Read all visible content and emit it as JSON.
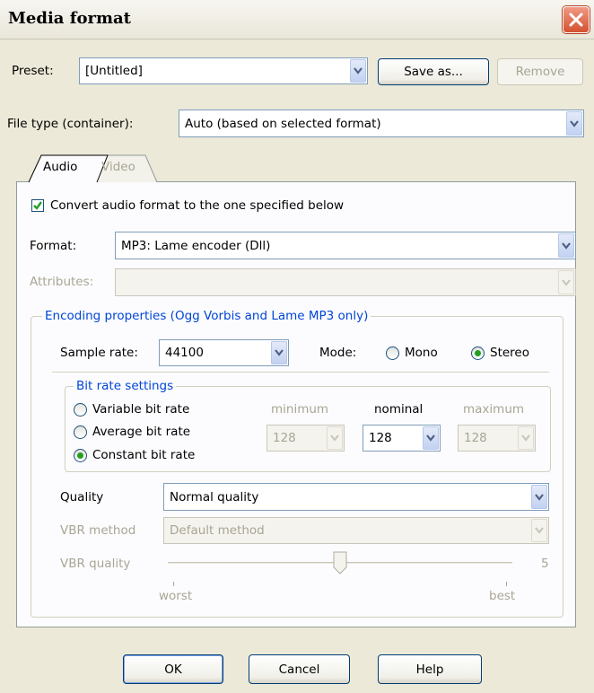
{
  "window": {
    "title": "Media format"
  },
  "preset": {
    "label": "Preset:",
    "value": "[Untitled]",
    "save_as_label": "Save as...",
    "remove_label": "Remove"
  },
  "file_type": {
    "label": "File type (container):",
    "value": "Auto (based on selected format)"
  },
  "tabs": [
    {
      "label": "Audio",
      "active": true
    },
    {
      "label": "Video",
      "active": false
    }
  ],
  "audio": {
    "convert_label": "Convert audio format to the one specified below",
    "convert_checked": true,
    "format_label": "Format:",
    "format_value": "MP3: Lame encoder (Dll)",
    "attributes_label": "Attributes:",
    "attributes_value": "",
    "encoding": {
      "title": "Encoding properties (Ogg Vorbis and Lame MP3 only)",
      "sample_rate_label": "Sample rate:",
      "sample_rate_value": "44100",
      "mode_label": "Mode:",
      "mono_label": "Mono",
      "stereo_label": "Stereo",
      "mode_selected": "Stereo",
      "bitrate": {
        "title": "Bit rate settings",
        "variable_label": "Variable bit rate",
        "average_label": "Average bit rate",
        "constant_label": "Constant bit rate",
        "selected": "Constant bit rate",
        "minimum_label": "minimum",
        "nominal_label": "nominal",
        "maximum_label": "maximum",
        "minimum_value": "128",
        "nominal_value": "128",
        "maximum_value": "128"
      },
      "quality_label": "Quality",
      "quality_value": "Normal quality",
      "vbr_method_label": "VBR method",
      "vbr_method_value": "Default method",
      "vbr_quality_label": "VBR quality",
      "vbr_quality_value": "5",
      "vbr_quality_slider_fraction": 0.5,
      "worst_label": "worst",
      "best_label": "best"
    }
  },
  "buttons": {
    "ok": "OK",
    "cancel": "Cancel",
    "help": "Help"
  },
  "colors": {
    "dialog_bg": "#ECE9D8",
    "group_title": "#0046D5",
    "close_button": "#D4512F",
    "radio_dot": "#21A121"
  }
}
